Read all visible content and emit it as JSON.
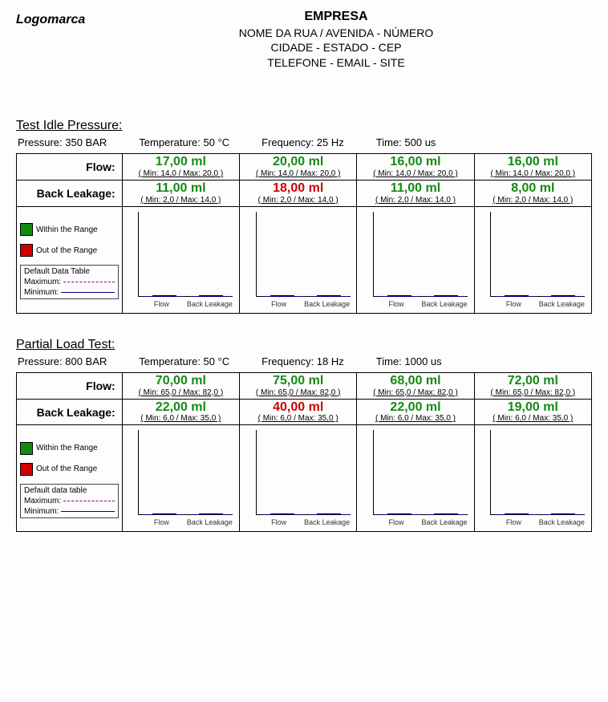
{
  "header": {
    "logo": "Logomarca",
    "company": "EMPRESA",
    "line1": "NOME DA RUA / AVENIDA - NÚMERO",
    "line2": "CIDADE - ESTADO - CEP",
    "line3": "TELEFONE - EMAIL - SITE"
  },
  "legend": {
    "within": "Within the Range",
    "out": "Out of the Range",
    "table_title1": "Default Data Table",
    "table_title2": "Default data table",
    "max": "Maximum:",
    "min": "Minimum:"
  },
  "axis": {
    "flow": "Flow",
    "back": "Back Leakage"
  },
  "rows": {
    "flow": "Flow:",
    "back": "Back Leakage:"
  },
  "sections": [
    {
      "id": "idle",
      "title": "Test Idle Pressure:",
      "params": {
        "pressure": "Pressure: 350 BAR",
        "temperature": "Temperature: 50 °C",
        "frequency": "Frequency: 25 Hz",
        "time": "Time: 500 us"
      },
      "flow": {
        "min": 14.0,
        "max": 20.0,
        "range_txt": "( Min: 14,0 / Max: 20,0 )",
        "vals": [
          {
            "txt": "17,00 ml",
            "v": 17.0,
            "ok": true
          },
          {
            "txt": "20,00 ml",
            "v": 20.0,
            "ok": true
          },
          {
            "txt": "16,00 ml",
            "v": 16.0,
            "ok": true
          },
          {
            "txt": "16,00 ml",
            "v": 16.0,
            "ok": true
          }
        ]
      },
      "back": {
        "min": 2.0,
        "max": 14.0,
        "range_txt": "( Min: 2,0 / Max: 14,0 )",
        "vals": [
          {
            "txt": "11,00 ml",
            "v": 11.0,
            "ok": true
          },
          {
            "txt": "18,00 ml",
            "v": 18.0,
            "ok": false
          },
          {
            "txt": "11,00 ml",
            "v": 11.0,
            "ok": true
          },
          {
            "txt": "8,00 ml",
            "v": 8.0,
            "ok": true
          }
        ]
      }
    },
    {
      "id": "partial",
      "title": "Partial Load Test:",
      "params": {
        "pressure": "Pressure: 800 BAR",
        "temperature": "Temperature: 50 °C",
        "frequency": "Frequency: 18 Hz",
        "time": "Time: 1000 us"
      },
      "flow": {
        "min": 65.0,
        "max": 82.0,
        "range_txt": "( Min: 65,0 / Max: 82,0 )",
        "vals": [
          {
            "txt": "70,00 ml",
            "v": 70.0,
            "ok": true
          },
          {
            "txt": "75,00 ml",
            "v": 75.0,
            "ok": true
          },
          {
            "txt": "68,00 ml",
            "v": 68.0,
            "ok": true
          },
          {
            "txt": "72,00 ml",
            "v": 72.0,
            "ok": true
          }
        ]
      },
      "back": {
        "min": 6.0,
        "max": 35.0,
        "range_txt": "( Min: 6,0 / Max: 35,0 )",
        "vals": [
          {
            "txt": "22,00 ml",
            "v": 22.0,
            "ok": true
          },
          {
            "txt": "40,00 ml",
            "v": 40.0,
            "ok": false
          },
          {
            "txt": "22,00 ml",
            "v": 22.0,
            "ok": true
          },
          {
            "txt": "19,00 ml",
            "v": 19.0,
            "ok": true
          }
        ]
      }
    }
  ],
  "chart_data": [
    {
      "type": "bar",
      "title": "Test Idle Pressure",
      "categories": [
        "Flow",
        "Back Leakage"
      ],
      "series_per_channel": 4,
      "flow": {
        "values": [
          17,
          20,
          16,
          16
        ],
        "min": 14,
        "max": 20,
        "unit": "ml"
      },
      "back": {
        "values": [
          11,
          18,
          11,
          8
        ],
        "min": 2,
        "max": 14,
        "unit": "ml"
      },
      "out_of_range_index": {
        "back": [
          1
        ]
      }
    },
    {
      "type": "bar",
      "title": "Partial Load Test",
      "categories": [
        "Flow",
        "Back Leakage"
      ],
      "series_per_channel": 4,
      "flow": {
        "values": [
          70,
          75,
          68,
          72
        ],
        "min": 65,
        "max": 82,
        "unit": "ml"
      },
      "back": {
        "values": [
          22,
          40,
          22,
          19
        ],
        "min": 6,
        "max": 35,
        "unit": "ml"
      },
      "out_of_range_index": {
        "back": [
          1
        ]
      }
    }
  ]
}
